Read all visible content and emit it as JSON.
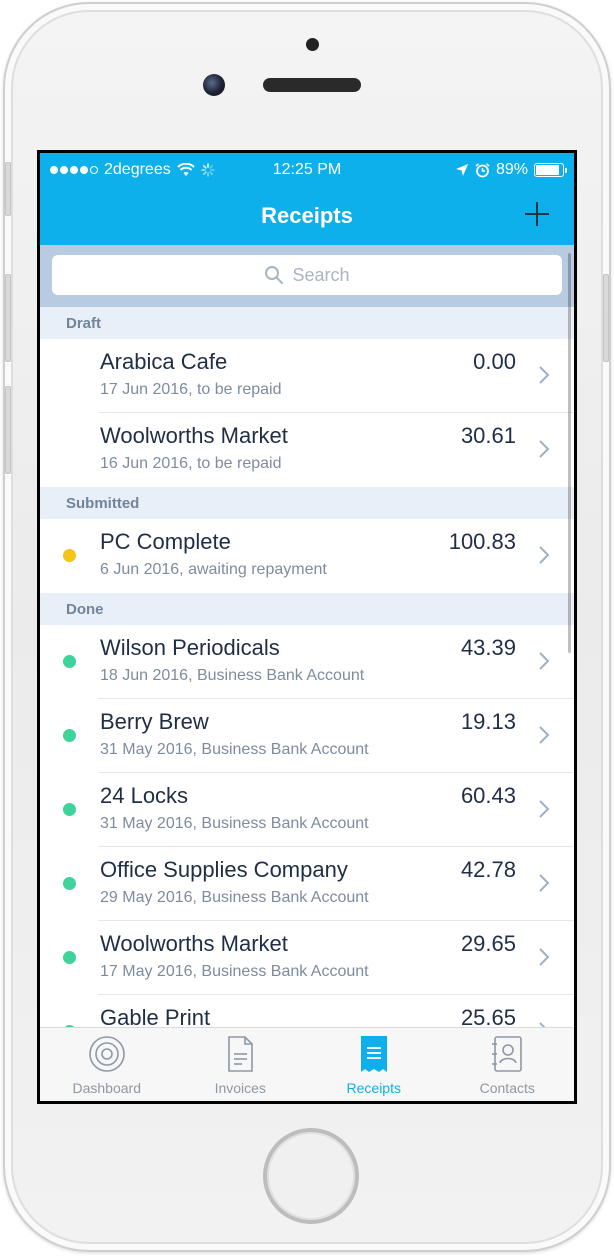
{
  "status_bar": {
    "carrier": "2degrees",
    "time": "12:25 PM",
    "battery": "89%",
    "battery_level": 0.89
  },
  "nav": {
    "title": "Receipts",
    "add_icon": "plus-icon"
  },
  "search": {
    "placeholder": "Search"
  },
  "colors": {
    "brand": "#0db0ea",
    "status_submitted": "#f5c518",
    "status_done": "#3ed39a"
  },
  "sections": [
    {
      "label": "Draft",
      "items": [
        {
          "title": "Arabica Cafe",
          "subtitle": "17 Jun 2016, to be repaid",
          "amount": "0.00",
          "status": "draft"
        },
        {
          "title": "Woolworths Market",
          "subtitle": "16 Jun 2016, to be repaid",
          "amount": "30.61",
          "status": "draft"
        }
      ]
    },
    {
      "label": "Submitted",
      "items": [
        {
          "title": "PC Complete",
          "subtitle": "6 Jun 2016, awaiting repayment",
          "amount": "100.83",
          "status": "submitted"
        }
      ]
    },
    {
      "label": "Done",
      "items": [
        {
          "title": "Wilson Periodicals",
          "subtitle": "18 Jun 2016, Business Bank Account",
          "amount": "43.39",
          "status": "done"
        },
        {
          "title": "Berry Brew",
          "subtitle": "31 May 2016, Business Bank Account",
          "amount": "19.13",
          "status": "done"
        },
        {
          "title": "24 Locks",
          "subtitle": "31 May 2016, Business Bank Account",
          "amount": "60.43",
          "status": "done"
        },
        {
          "title": "Office Supplies Company",
          "subtitle": "29 May 2016, Business Bank Account",
          "amount": "42.78",
          "status": "done"
        },
        {
          "title": "Woolworths Market",
          "subtitle": "17 May 2016, Business Bank Account",
          "amount": "29.65",
          "status": "done"
        },
        {
          "title": "Gable Print",
          "subtitle": "",
          "amount": "25.65",
          "status": "done"
        }
      ]
    }
  ],
  "tabs": [
    {
      "label": "Dashboard",
      "icon": "dashboard-icon",
      "active": false
    },
    {
      "label": "Invoices",
      "icon": "invoice-icon",
      "active": false
    },
    {
      "label": "Receipts",
      "icon": "receipt-icon",
      "active": true
    },
    {
      "label": "Contacts",
      "icon": "contacts-icon",
      "active": false
    }
  ]
}
